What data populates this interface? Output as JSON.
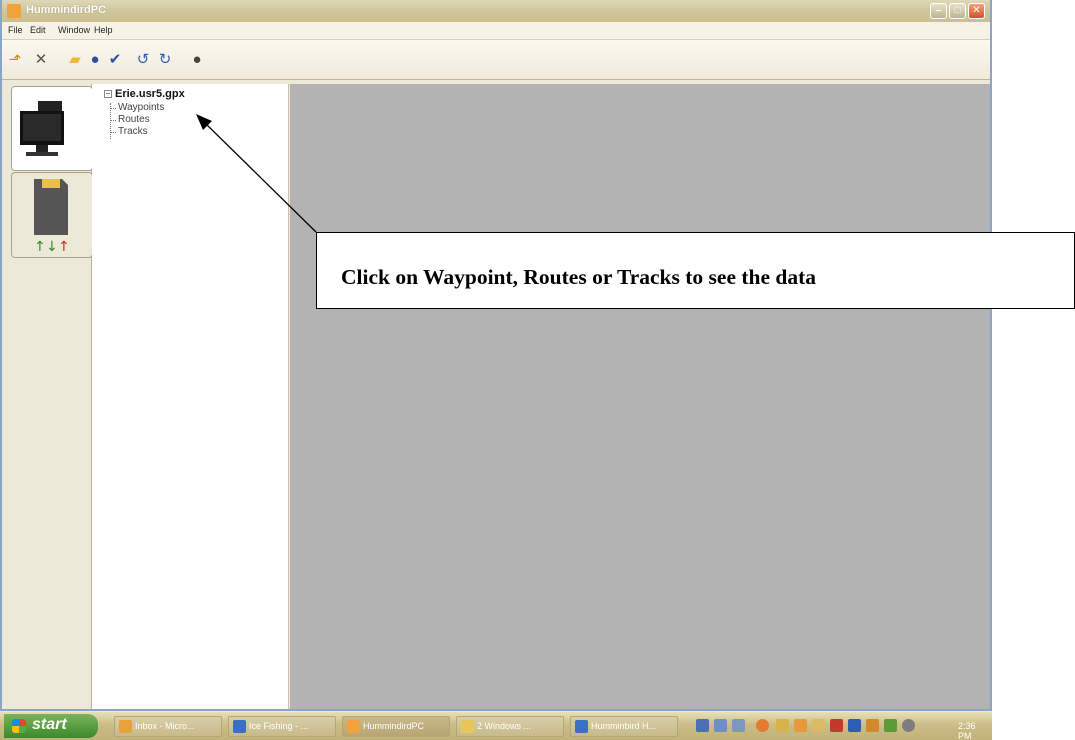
{
  "window": {
    "title": "HummindirdPC"
  },
  "menubar": {
    "items": [
      "File",
      "Edit",
      "Window",
      "Help"
    ]
  },
  "toolbar": {
    "buttons": [
      {
        "name": "new-icon",
        "glyph": "⬏",
        "color": "#c98b2a"
      },
      {
        "name": "delete-icon",
        "glyph": "✕",
        "color": "#555"
      },
      {
        "name": "open-folder-icon",
        "glyph": "▰",
        "color": "#e8b93c"
      },
      {
        "name": "globe-icon",
        "glyph": "●",
        "color": "#2d4fa3"
      },
      {
        "name": "hummingbird-icon",
        "glyph": "✔",
        "color": "#2d4fa3"
      },
      {
        "name": "undo-icon",
        "glyph": "↺",
        "color": "#355fb0"
      },
      {
        "name": "redo-icon",
        "glyph": "↻",
        "color": "#355fb0"
      },
      {
        "name": "stop-icon",
        "glyph": "●",
        "color": "#444"
      }
    ]
  },
  "tree": {
    "root": "Erie.usr5.gpx",
    "children": [
      "Waypoints",
      "Routes",
      "Tracks"
    ]
  },
  "callout": {
    "text": "Click on Waypoint, Routes or Tracks to see the data"
  },
  "taskbar": {
    "start": "start",
    "tasks": [
      {
        "label": "Inbox - Micro...",
        "color": "#e8a23a"
      },
      {
        "label": "Ice Fishing - ...",
        "color": "#3a6fc2"
      },
      {
        "label": "HummindirdPC",
        "color": "#f2a23a"
      },
      {
        "label": "2 Windows ...",
        "color": "#e8c75a"
      },
      {
        "label": "Humminbird H...",
        "color": "#3a6fc2"
      }
    ],
    "clock": "2:36 PM"
  },
  "colors": {
    "content_bg": "#b3b3b3",
    "window_bg": "#ece9d8"
  }
}
